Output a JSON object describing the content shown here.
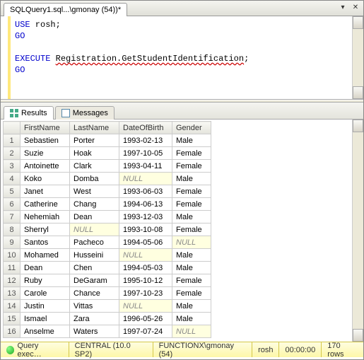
{
  "tab": {
    "title": "SQLQuery1.sql...\\gmonay (54))*"
  },
  "editor": {
    "line1_kw": "USE",
    "line1_txt": " rosh;",
    "line2": "GO",
    "line4_kw": "EXECUTE",
    "line4_txt": " ",
    "line4_u": "Registration.GetStudentIdentification",
    "line4_end": ";",
    "line5": "GO"
  },
  "resultsTabs": {
    "results": "Results",
    "messages": "Messages"
  },
  "columns": [
    "FirstName",
    "LastName",
    "DateOfBirth",
    "Gender"
  ],
  "rows": [
    {
      "n": "1",
      "fn": "Sebastien",
      "ln": "Porter",
      "dob": "1993-02-13",
      "g": "Male"
    },
    {
      "n": "2",
      "fn": "Suzie",
      "ln": "Hoak",
      "dob": "1997-10-05",
      "g": "Female"
    },
    {
      "n": "3",
      "fn": "Antoinette",
      "ln": "Clark",
      "dob": "1993-04-11",
      "g": "Female"
    },
    {
      "n": "4",
      "fn": "Koko",
      "ln": "Domba",
      "dob": null,
      "g": "Male"
    },
    {
      "n": "5",
      "fn": "Janet",
      "ln": "West",
      "dob": "1993-06-03",
      "g": "Female"
    },
    {
      "n": "6",
      "fn": "Catherine",
      "ln": "Chang",
      "dob": "1994-06-13",
      "g": "Female"
    },
    {
      "n": "7",
      "fn": "Nehemiah",
      "ln": "Dean",
      "dob": "1993-12-03",
      "g": "Male"
    },
    {
      "n": "8",
      "fn": "Sherryl",
      "ln": null,
      "dob": "1993-10-08",
      "g": "Female"
    },
    {
      "n": "9",
      "fn": "Santos",
      "ln": "Pacheco",
      "dob": "1994-05-06",
      "g": null
    },
    {
      "n": "10",
      "fn": "Mohamed",
      "ln": "Husseini",
      "dob": null,
      "g": "Male"
    },
    {
      "n": "11",
      "fn": "Dean",
      "ln": "Chen",
      "dob": "1994-05-03",
      "g": "Male"
    },
    {
      "n": "12",
      "fn": "Ruby",
      "ln": "DeGaram",
      "dob": "1995-10-12",
      "g": "Female"
    },
    {
      "n": "13",
      "fn": "Carole",
      "ln": "Chance",
      "dob": "1997-10-23",
      "g": "Female"
    },
    {
      "n": "14",
      "fn": "Justin",
      "ln": "Vittas",
      "dob": null,
      "g": "Male"
    },
    {
      "n": "15",
      "fn": "Ismael",
      "ln": "Zara",
      "dob": "1996-05-26",
      "g": "Male"
    },
    {
      "n": "16",
      "fn": "Anselme",
      "ln": "Waters",
      "dob": "1997-07-24",
      "g": null
    }
  ],
  "nullText": "NULL",
  "status": {
    "exec": "Query exec…",
    "server": "CENTRAL (10.0 SP2)",
    "user": "FUNCTIONX\\gmonay (54)",
    "db": "rosh",
    "time": "00:00:00",
    "rows": "170 rows"
  }
}
